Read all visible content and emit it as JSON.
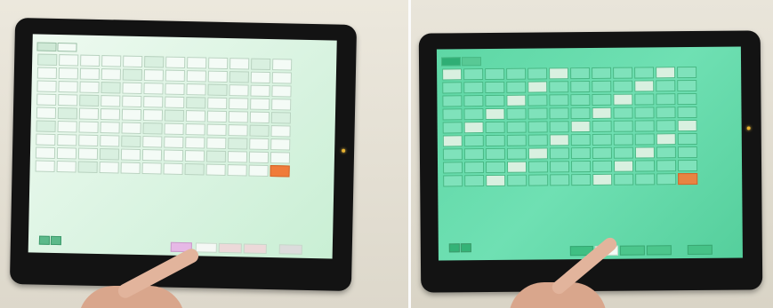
{
  "left_photo": {
    "screen_title": "",
    "tab_1": "",
    "tab_2": "",
    "brand": "",
    "system_label": "",
    "device_logo": "",
    "screen_tint": "#d8f3e0"
  },
  "right_photo": {
    "screen_title": "",
    "tab_1": "",
    "tab_2": "",
    "brand": "",
    "system_label": "",
    "device_logo": "",
    "screen_tint": "#6fe0b3"
  },
  "colors": {
    "bezel": "#131313",
    "wall": "#e4dfd3",
    "accent_cell": "#f07b3a",
    "camera_led": "#e8b230",
    "skin": "#e2b49c"
  }
}
